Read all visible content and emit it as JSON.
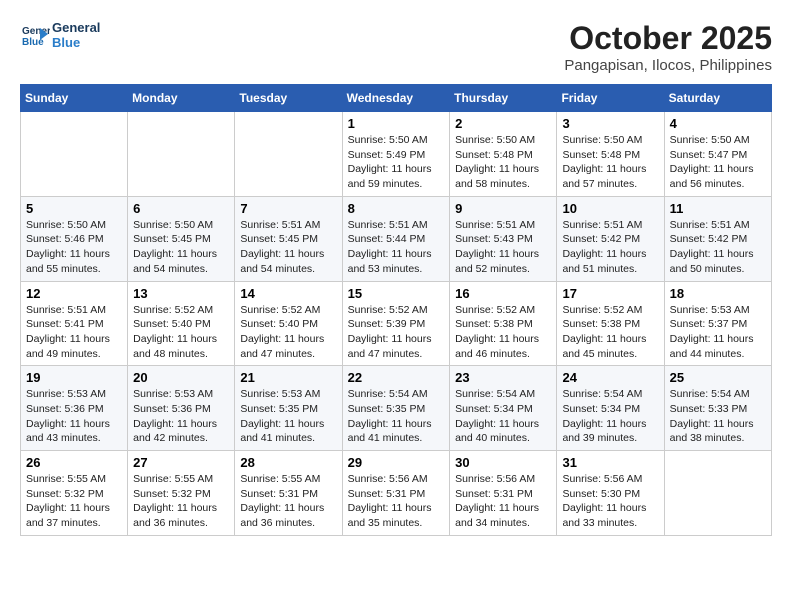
{
  "header": {
    "logo_line1": "General",
    "logo_line2": "Blue",
    "month": "October 2025",
    "location": "Pangapisan, Ilocos, Philippines"
  },
  "weekdays": [
    "Sunday",
    "Monday",
    "Tuesday",
    "Wednesday",
    "Thursday",
    "Friday",
    "Saturday"
  ],
  "weeks": [
    [
      {
        "day": "",
        "info": ""
      },
      {
        "day": "",
        "info": ""
      },
      {
        "day": "",
        "info": ""
      },
      {
        "day": "1",
        "info": "Sunrise: 5:50 AM\nSunset: 5:49 PM\nDaylight: 11 hours\nand 59 minutes."
      },
      {
        "day": "2",
        "info": "Sunrise: 5:50 AM\nSunset: 5:48 PM\nDaylight: 11 hours\nand 58 minutes."
      },
      {
        "day": "3",
        "info": "Sunrise: 5:50 AM\nSunset: 5:48 PM\nDaylight: 11 hours\nand 57 minutes."
      },
      {
        "day": "4",
        "info": "Sunrise: 5:50 AM\nSunset: 5:47 PM\nDaylight: 11 hours\nand 56 minutes."
      }
    ],
    [
      {
        "day": "5",
        "info": "Sunrise: 5:50 AM\nSunset: 5:46 PM\nDaylight: 11 hours\nand 55 minutes."
      },
      {
        "day": "6",
        "info": "Sunrise: 5:50 AM\nSunset: 5:45 PM\nDaylight: 11 hours\nand 54 minutes."
      },
      {
        "day": "7",
        "info": "Sunrise: 5:51 AM\nSunset: 5:45 PM\nDaylight: 11 hours\nand 54 minutes."
      },
      {
        "day": "8",
        "info": "Sunrise: 5:51 AM\nSunset: 5:44 PM\nDaylight: 11 hours\nand 53 minutes."
      },
      {
        "day": "9",
        "info": "Sunrise: 5:51 AM\nSunset: 5:43 PM\nDaylight: 11 hours\nand 52 minutes."
      },
      {
        "day": "10",
        "info": "Sunrise: 5:51 AM\nSunset: 5:42 PM\nDaylight: 11 hours\nand 51 minutes."
      },
      {
        "day": "11",
        "info": "Sunrise: 5:51 AM\nSunset: 5:42 PM\nDaylight: 11 hours\nand 50 minutes."
      }
    ],
    [
      {
        "day": "12",
        "info": "Sunrise: 5:51 AM\nSunset: 5:41 PM\nDaylight: 11 hours\nand 49 minutes."
      },
      {
        "day": "13",
        "info": "Sunrise: 5:52 AM\nSunset: 5:40 PM\nDaylight: 11 hours\nand 48 minutes."
      },
      {
        "day": "14",
        "info": "Sunrise: 5:52 AM\nSunset: 5:40 PM\nDaylight: 11 hours\nand 47 minutes."
      },
      {
        "day": "15",
        "info": "Sunrise: 5:52 AM\nSunset: 5:39 PM\nDaylight: 11 hours\nand 47 minutes."
      },
      {
        "day": "16",
        "info": "Sunrise: 5:52 AM\nSunset: 5:38 PM\nDaylight: 11 hours\nand 46 minutes."
      },
      {
        "day": "17",
        "info": "Sunrise: 5:52 AM\nSunset: 5:38 PM\nDaylight: 11 hours\nand 45 minutes."
      },
      {
        "day": "18",
        "info": "Sunrise: 5:53 AM\nSunset: 5:37 PM\nDaylight: 11 hours\nand 44 minutes."
      }
    ],
    [
      {
        "day": "19",
        "info": "Sunrise: 5:53 AM\nSunset: 5:36 PM\nDaylight: 11 hours\nand 43 minutes."
      },
      {
        "day": "20",
        "info": "Sunrise: 5:53 AM\nSunset: 5:36 PM\nDaylight: 11 hours\nand 42 minutes."
      },
      {
        "day": "21",
        "info": "Sunrise: 5:53 AM\nSunset: 5:35 PM\nDaylight: 11 hours\nand 41 minutes."
      },
      {
        "day": "22",
        "info": "Sunrise: 5:54 AM\nSunset: 5:35 PM\nDaylight: 11 hours\nand 41 minutes."
      },
      {
        "day": "23",
        "info": "Sunrise: 5:54 AM\nSunset: 5:34 PM\nDaylight: 11 hours\nand 40 minutes."
      },
      {
        "day": "24",
        "info": "Sunrise: 5:54 AM\nSunset: 5:34 PM\nDaylight: 11 hours\nand 39 minutes."
      },
      {
        "day": "25",
        "info": "Sunrise: 5:54 AM\nSunset: 5:33 PM\nDaylight: 11 hours\nand 38 minutes."
      }
    ],
    [
      {
        "day": "26",
        "info": "Sunrise: 5:55 AM\nSunset: 5:32 PM\nDaylight: 11 hours\nand 37 minutes."
      },
      {
        "day": "27",
        "info": "Sunrise: 5:55 AM\nSunset: 5:32 PM\nDaylight: 11 hours\nand 36 minutes."
      },
      {
        "day": "28",
        "info": "Sunrise: 5:55 AM\nSunset: 5:31 PM\nDaylight: 11 hours\nand 36 minutes."
      },
      {
        "day": "29",
        "info": "Sunrise: 5:56 AM\nSunset: 5:31 PM\nDaylight: 11 hours\nand 35 minutes."
      },
      {
        "day": "30",
        "info": "Sunrise: 5:56 AM\nSunset: 5:31 PM\nDaylight: 11 hours\nand 34 minutes."
      },
      {
        "day": "31",
        "info": "Sunrise: 5:56 AM\nSunset: 5:30 PM\nDaylight: 11 hours\nand 33 minutes."
      },
      {
        "day": "",
        "info": ""
      }
    ]
  ]
}
